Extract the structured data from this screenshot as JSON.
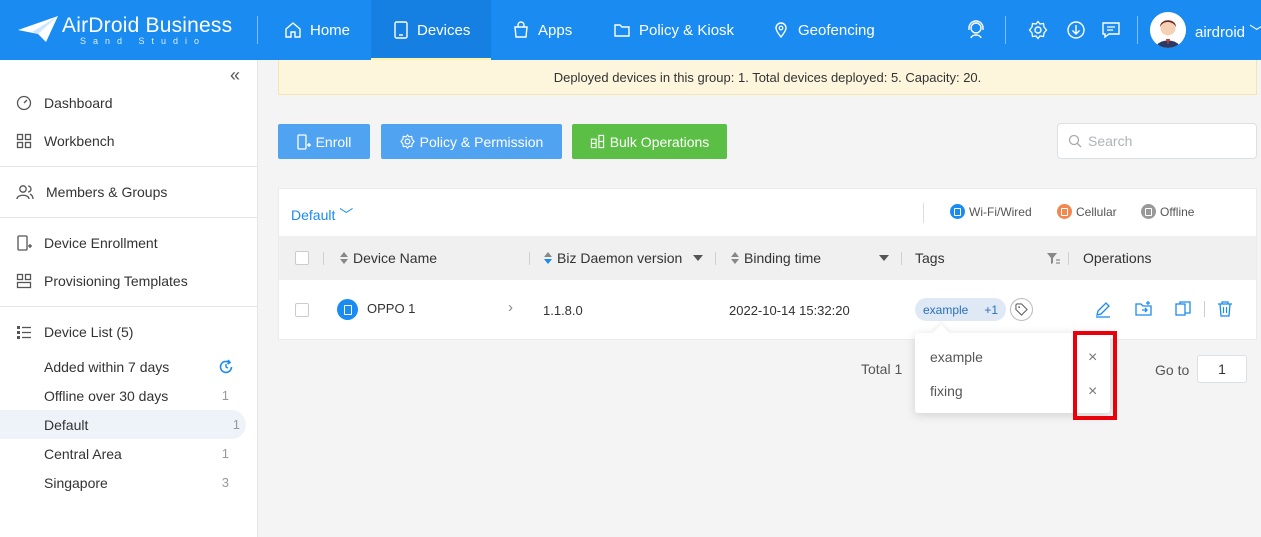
{
  "brand": {
    "title": "AirDroid Business",
    "subtitle": "Sand Studio",
    "color": "#1a8bf0"
  },
  "nav": {
    "items": [
      {
        "label": "Home",
        "icon": "home-icon"
      },
      {
        "label": "Devices",
        "icon": "tablet-icon",
        "active": true
      },
      {
        "label": "Apps",
        "icon": "bag-icon"
      },
      {
        "label": "Policy & Kiosk",
        "icon": "folder-icon"
      },
      {
        "label": "Geofencing",
        "icon": "map-icon"
      }
    ],
    "right_icons": [
      "support-agent-icon",
      "settings-icon",
      "download-icon",
      "message-icon"
    ],
    "user": "airdroid"
  },
  "sidebar": {
    "collapse": "«",
    "items": [
      {
        "label": "Dashboard",
        "icon": "dashboard-icon"
      },
      {
        "label": "Workbench",
        "icon": "workbench-icon"
      },
      {
        "label": "Members & Groups",
        "icon": "members-icon"
      },
      {
        "label": "Device Enrollment",
        "icon": "enrollment-icon"
      },
      {
        "label": "Provisioning Templates",
        "icon": "templates-icon"
      },
      {
        "label": "Device List (5)",
        "icon": "list-icon"
      }
    ],
    "groups": [
      {
        "label": "Added within 7 days",
        "count": ""
      },
      {
        "label": "Offline over 30 days",
        "count": "1"
      },
      {
        "label": "Default",
        "count": "1",
        "active": true
      },
      {
        "label": "Central Area",
        "count": "1"
      },
      {
        "label": "Singapore",
        "count": "3"
      }
    ]
  },
  "banner": "Deployed devices in this group: 1. Total devices deployed: 5. Capacity: 20.",
  "toolbar": {
    "enroll": "Enroll",
    "policy": "Policy & Permission",
    "bulk": "Bulk Operations",
    "search_placeholder": "Search"
  },
  "table": {
    "group": "Default",
    "legend": [
      {
        "label": "Wi-Fi/Wired",
        "color": "#1a8bf0"
      },
      {
        "label": "Cellular",
        "color": "#f0884f"
      },
      {
        "label": "Offline",
        "color": "#999999"
      }
    ],
    "columns": {
      "name": "Device Name",
      "daemon": "Biz Daemon version",
      "binding": "Binding time",
      "tags": "Tags",
      "ops": "Operations"
    },
    "rows": [
      {
        "name": "OPPO 1",
        "daemon": "1.1.8.0",
        "binding": "2022-10-14 15:32:20",
        "tag": "example",
        "tag_more": "+1"
      }
    ]
  },
  "pager": {
    "total": "Total 1",
    "goto_label": "Go to",
    "goto_value": "1"
  },
  "tag_popover": {
    "items": [
      "example",
      "fixing"
    ],
    "remove": "×"
  },
  "highlight_color": "#e8000b"
}
